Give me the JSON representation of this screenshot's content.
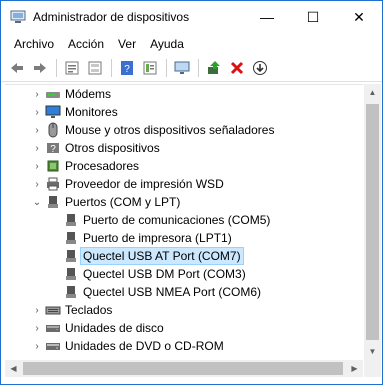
{
  "window": {
    "title": "Administrador de dispositivos",
    "minimize": "—",
    "maximize": "☐",
    "close": "✕"
  },
  "menu": [
    "Archivo",
    "Acción",
    "Ver",
    "Ayuda"
  ],
  "toolbar": [
    "back-icon",
    "forward-icon",
    "properties-icon",
    "show-hidden-icon",
    "help-icon",
    "view-icon",
    "monitor-icon",
    "update-driver-icon",
    "uninstall-icon",
    "scan-icon"
  ],
  "tree": [
    {
      "label": "Módems",
      "level": 0,
      "expander": "›",
      "icon": "modem-icon"
    },
    {
      "label": "Monitores",
      "level": 0,
      "expander": "›",
      "icon": "monitor-icon"
    },
    {
      "label": "Mouse y otros dispositivos señaladores",
      "level": 0,
      "expander": "›",
      "icon": "mouse-icon"
    },
    {
      "label": "Otros dispositivos",
      "level": 0,
      "expander": "›",
      "icon": "other-device-icon"
    },
    {
      "label": "Procesadores",
      "level": 0,
      "expander": "›",
      "icon": "processor-icon"
    },
    {
      "label": "Proveedor de impresión WSD",
      "level": 0,
      "expander": "›",
      "icon": "printer-icon"
    },
    {
      "label": "Puertos (COM y LPT)",
      "level": 0,
      "expander": "⌄",
      "icon": "port-icon"
    },
    {
      "label": "Puerto de comunicaciones (COM5)",
      "level": 1,
      "expander": "",
      "icon": "port-icon"
    },
    {
      "label": "Puerto de impresora (LPT1)",
      "level": 1,
      "expander": "",
      "icon": "port-icon"
    },
    {
      "label": "Quectel USB AT Port (COM7)",
      "level": 1,
      "expander": "",
      "icon": "port-icon",
      "selected": true
    },
    {
      "label": "Quectel USB DM Port (COM3)",
      "level": 1,
      "expander": "",
      "icon": "port-icon"
    },
    {
      "label": "Quectel USB NMEA Port (COM6)",
      "level": 1,
      "expander": "",
      "icon": "port-icon"
    },
    {
      "label": "Teclados",
      "level": 0,
      "expander": "›",
      "icon": "keyboard-icon"
    },
    {
      "label": "Unidades de disco",
      "level": 0,
      "expander": "›",
      "icon": "disk-icon"
    },
    {
      "label": "Unidades de DVD o CD-ROM",
      "level": 0,
      "expander": "›",
      "icon": "dvd-icon"
    }
  ],
  "colors": {
    "accent": "#1e6fd0",
    "selection": "#cce8ff",
    "selection_border": "#99d1ff"
  }
}
